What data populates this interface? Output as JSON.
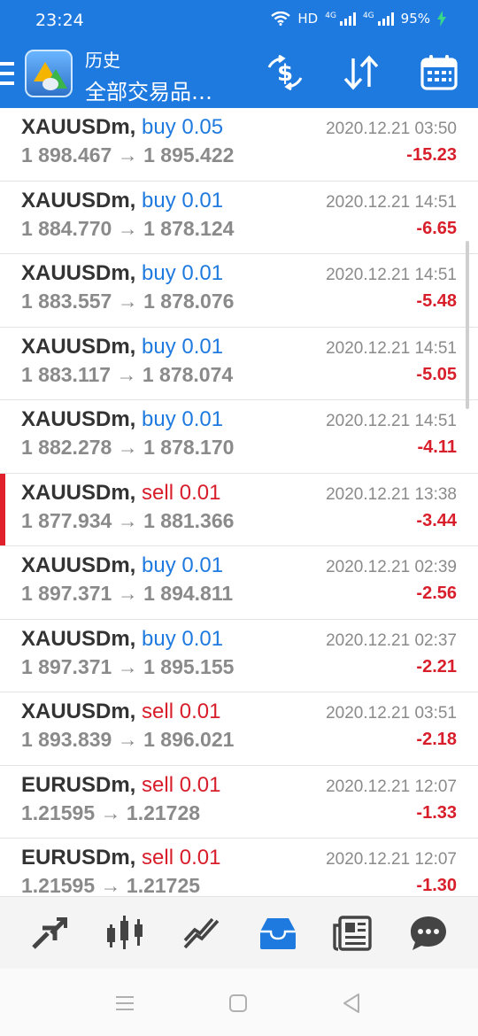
{
  "status": {
    "time": "23:24",
    "hd": "HD",
    "net1": "4G",
    "net2": "4G",
    "battery": "95%"
  },
  "header": {
    "title": "历史",
    "subtitle": "全部交易品…"
  },
  "trades": [
    {
      "symbol": "XAUUSDm,",
      "side": "buy",
      "volume": "0.05",
      "open": "1 898.467",
      "close": "1 895.422",
      "date": "2020.12.21 03:50",
      "profit": "-15.23"
    },
    {
      "symbol": "XAUUSDm,",
      "side": "buy",
      "volume": "0.01",
      "open": "1 884.770",
      "close": "1 878.124",
      "date": "2020.12.21 14:51",
      "profit": "-6.65"
    },
    {
      "symbol": "XAUUSDm,",
      "side": "buy",
      "volume": "0.01",
      "open": "1 883.557",
      "close": "1 878.076",
      "date": "2020.12.21 14:51",
      "profit": "-5.48"
    },
    {
      "symbol": "XAUUSDm,",
      "side": "buy",
      "volume": "0.01",
      "open": "1 883.117",
      "close": "1 878.074",
      "date": "2020.12.21 14:51",
      "profit": "-5.05"
    },
    {
      "symbol": "XAUUSDm,",
      "side": "buy",
      "volume": "0.01",
      "open": "1 882.278",
      "close": "1 878.170",
      "date": "2020.12.21 14:51",
      "profit": "-4.11"
    },
    {
      "symbol": "XAUUSDm,",
      "side": "sell",
      "volume": "0.01",
      "open": "1 877.934",
      "close": "1 881.366",
      "date": "2020.12.21 13:38",
      "profit": "-3.44",
      "selected": true
    },
    {
      "symbol": "XAUUSDm,",
      "side": "buy",
      "volume": "0.01",
      "open": "1 897.371",
      "close": "1 894.811",
      "date": "2020.12.21 02:39",
      "profit": "-2.56"
    },
    {
      "symbol": "XAUUSDm,",
      "side": "buy",
      "volume": "0.01",
      "open": "1 897.371",
      "close": "1 895.155",
      "date": "2020.12.21 02:37",
      "profit": "-2.21"
    },
    {
      "symbol": "XAUUSDm,",
      "side": "sell",
      "volume": "0.01",
      "open": "1 893.839",
      "close": "1 896.021",
      "date": "2020.12.21 03:51",
      "profit": "-2.18"
    },
    {
      "symbol": "EURUSDm,",
      "side": "sell",
      "volume": "0.01",
      "open": "1.21595",
      "close": "1.21728",
      "date": "2020.12.21 12:07",
      "profit": "-1.33"
    },
    {
      "symbol": "EURUSDm,",
      "side": "sell",
      "volume": "0.01",
      "open": "1.21595",
      "close": "1.21725",
      "date": "2020.12.21 12:07",
      "profit": "-1.30"
    }
  ],
  "arrow": "→",
  "toolbar": [
    "quotes-icon",
    "chart-icon",
    "trade-icon",
    "history-icon",
    "news-icon",
    "chat-icon"
  ],
  "colors": {
    "header": "#1f7ae0",
    "buy": "#1f7ae0",
    "sell": "#d81e2a",
    "loss": "#d81e2a",
    "muted": "#8a8a8a",
    "active_tab": "#1f7ae0",
    "inactive_tab": "#444444"
  }
}
